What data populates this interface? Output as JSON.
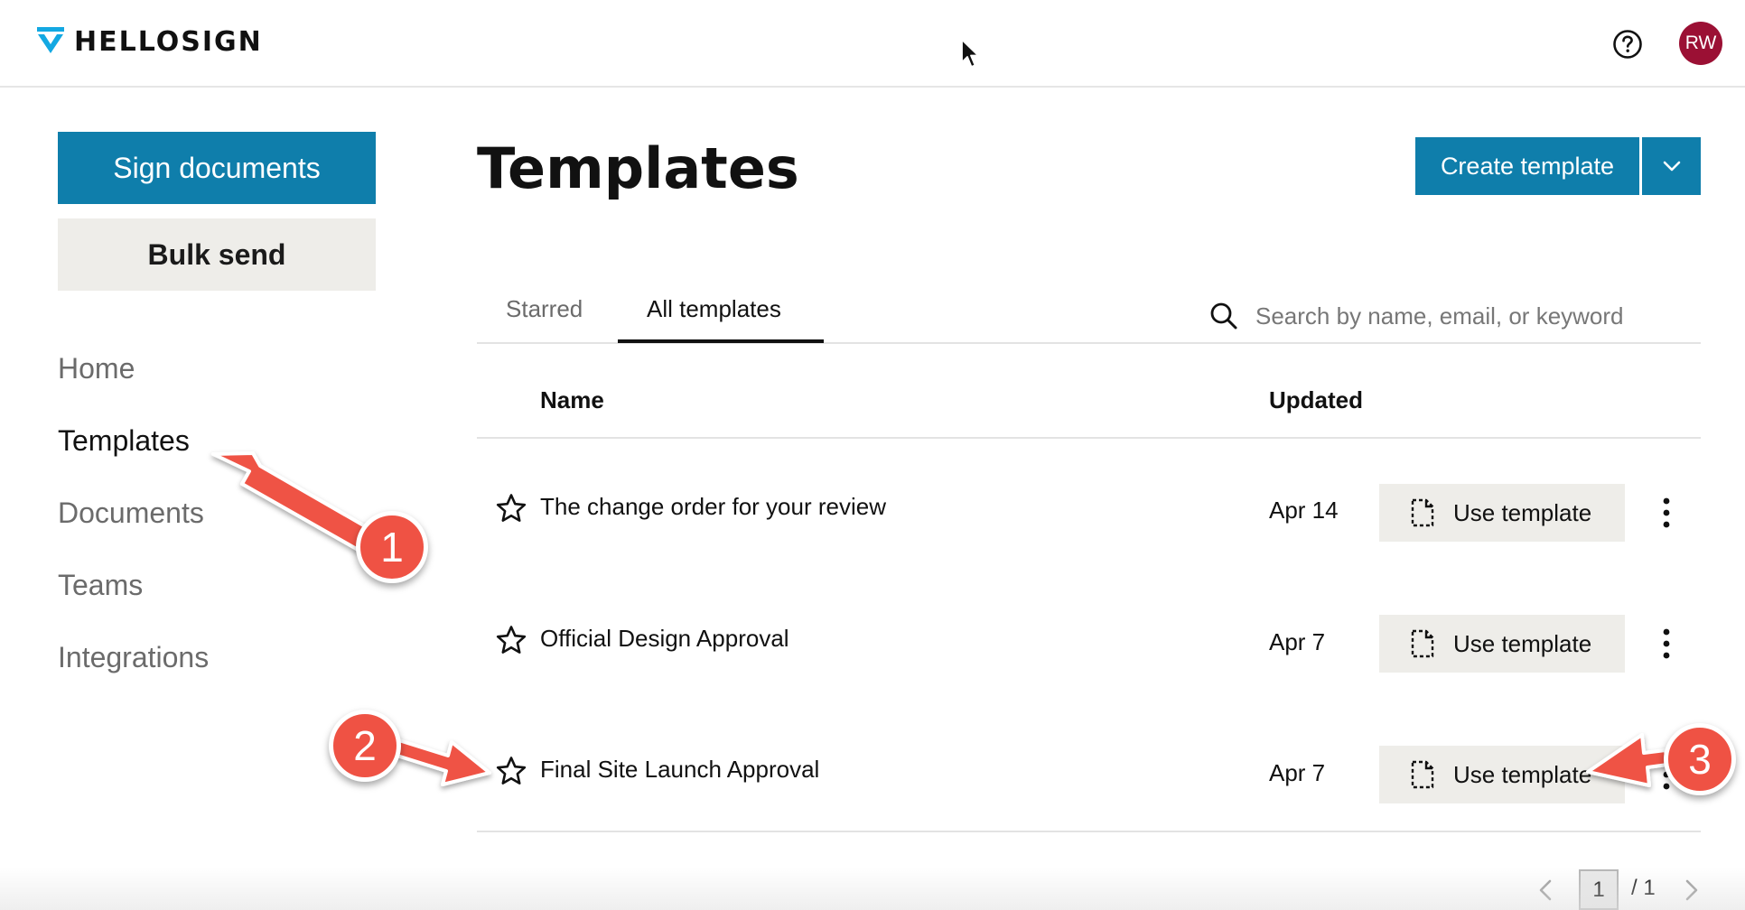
{
  "header": {
    "brand": "HELLOSIGN",
    "user_initials": "RW",
    "brand_color": "#13a8e2",
    "avatar_color": "#9b1034"
  },
  "sidebar": {
    "sign_button": "Sign documents",
    "bulk_button": "Bulk send",
    "nav": [
      {
        "label": "Home",
        "active": false
      },
      {
        "label": "Templates",
        "active": true
      },
      {
        "label": "Documents",
        "active": false
      },
      {
        "label": "Teams",
        "active": false
      },
      {
        "label": "Integrations",
        "active": false
      }
    ]
  },
  "main": {
    "title": "Templates",
    "create_button": "Create template",
    "tabs": [
      {
        "label": "Starred",
        "selected": false
      },
      {
        "label": "All templates",
        "selected": true
      }
    ],
    "search": {
      "placeholder": "Search by name, email, or keyword",
      "value": ""
    },
    "columns": {
      "name": "Name",
      "updated": "Updated"
    },
    "rows": [
      {
        "name": "The change order for your review",
        "updated": "Apr 14",
        "action": "Use template",
        "starred": false
      },
      {
        "name": "Official Design Approval",
        "updated": "Apr 7",
        "action": "Use template",
        "starred": false
      },
      {
        "name": "Final Site Launch Approval",
        "updated": "Apr 7",
        "action": "Use template",
        "starred": false
      }
    ],
    "pagination": {
      "current": "1",
      "total": "/ 1"
    }
  },
  "annotations": {
    "badges": [
      "1",
      "2",
      "3"
    ],
    "color": "#ef5244"
  },
  "colors": {
    "primary": "#0f7eab",
    "secondary_button": "#eeede9"
  }
}
